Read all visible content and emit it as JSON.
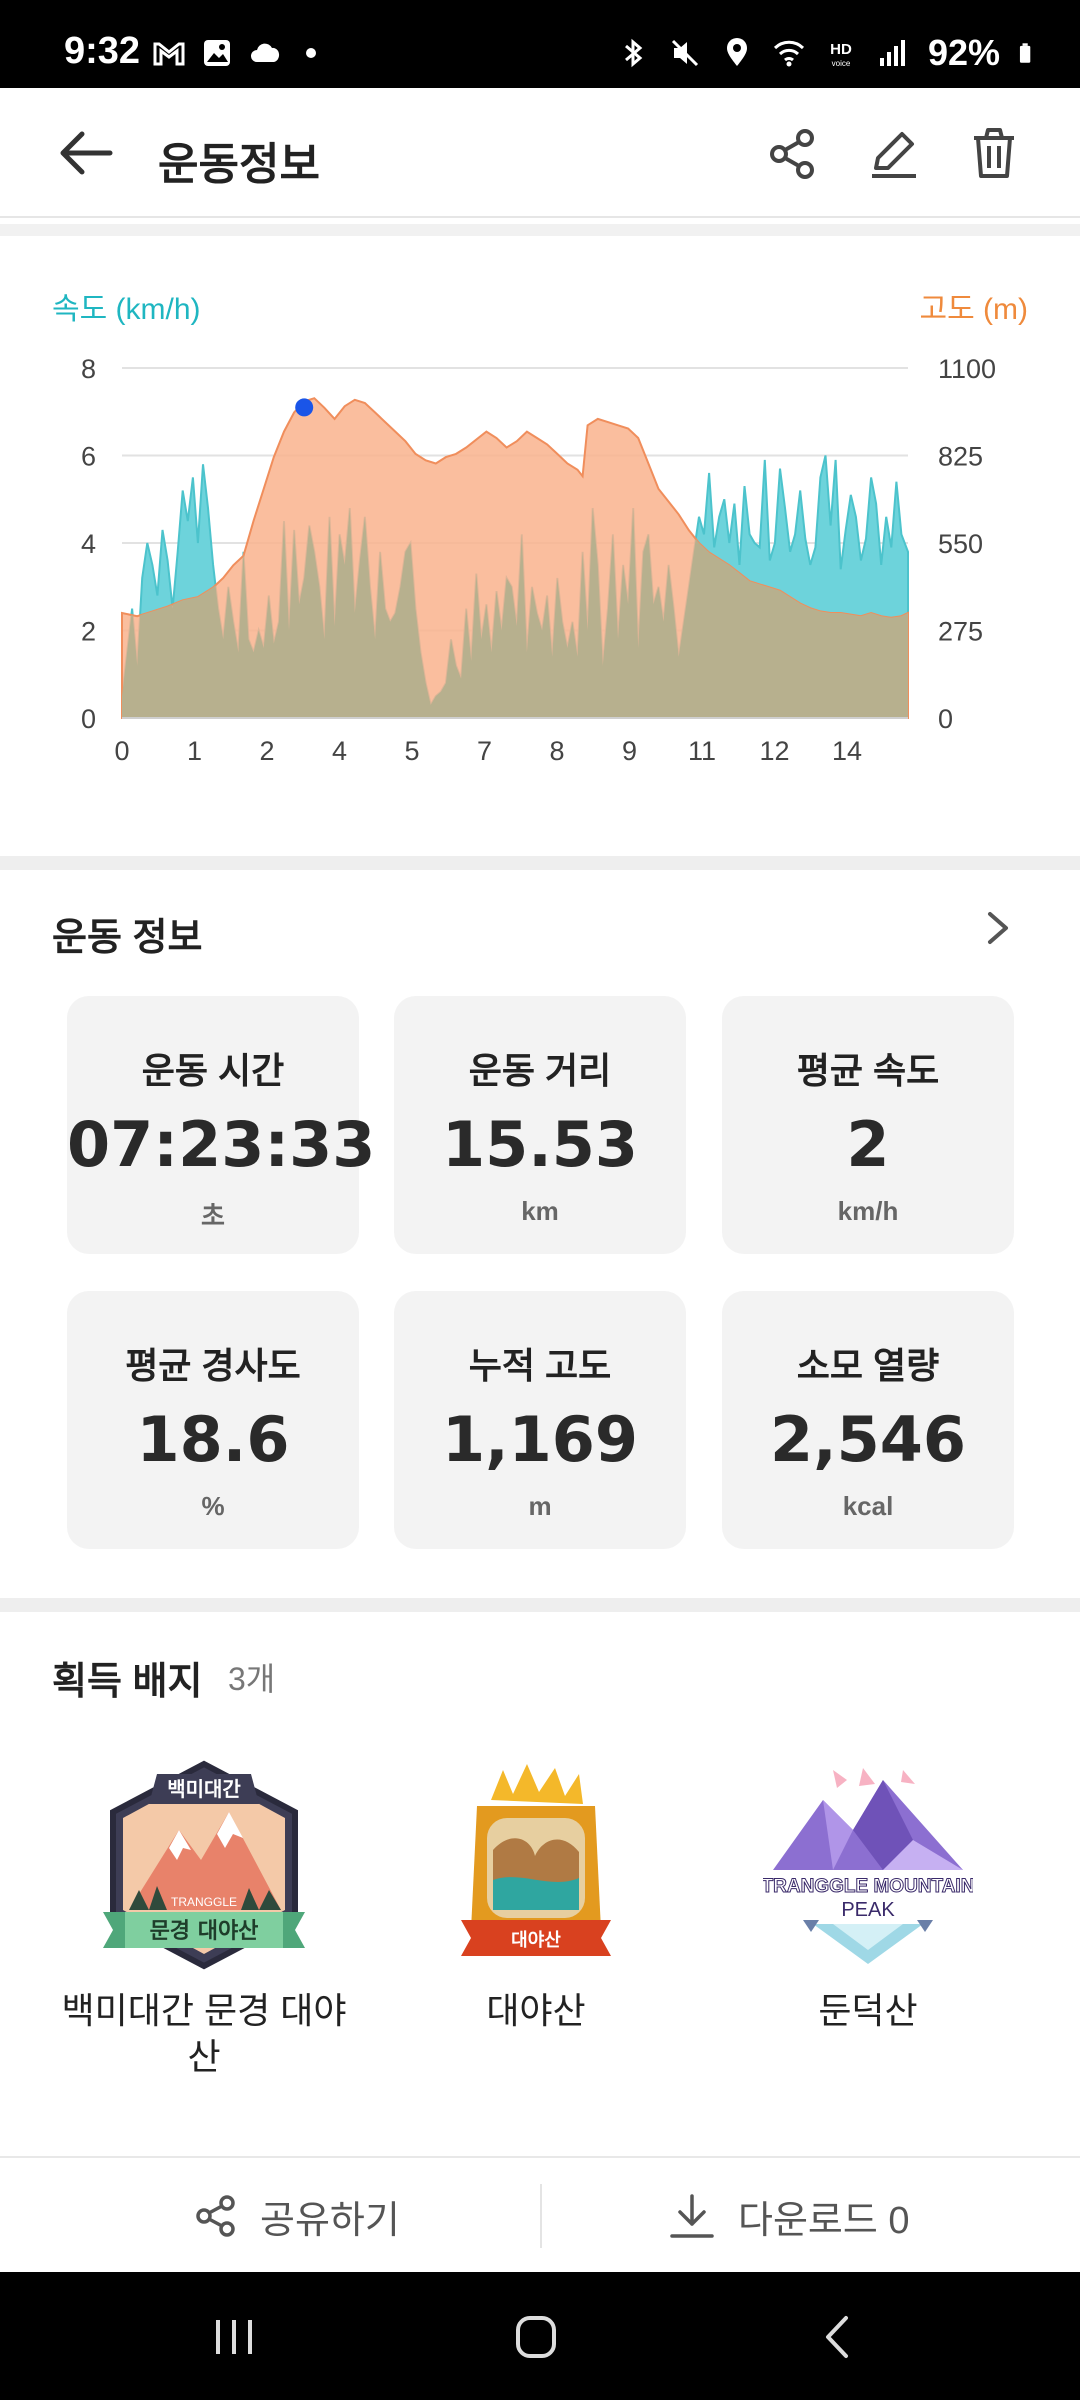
{
  "status_bar": {
    "time": "9:32",
    "battery": "92%",
    "left_icons": [
      "gmail-icon",
      "gallery-icon",
      "cloud-icon",
      "dot"
    ],
    "right_icons": [
      "bluetooth-icon",
      "mute-icon",
      "location-icon",
      "wifi-icon",
      "hd-voice-icon",
      "signal-icon",
      "battery-icon"
    ]
  },
  "app_bar": {
    "title": "운동정보",
    "actions": [
      "share-icon",
      "edit-icon",
      "trash-icon"
    ]
  },
  "chart": {
    "left_axis_label": "속도 (km/h)",
    "right_axis_label": "고도 (m)",
    "colors": {
      "speed": "#6dd3db",
      "altitude": "#f9b38d",
      "overlap": "#b7b08e",
      "marker": "#1a55e8"
    }
  },
  "chart_data": {
    "type": "area",
    "xlabel": "",
    "x_ticks": [
      "0",
      "1",
      "2",
      "4",
      "5",
      "7",
      "8",
      "9",
      "11",
      "12",
      "14"
    ],
    "x_range": [
      0,
      15.53
    ],
    "y_left": {
      "label": "속도 (km/h)",
      "ticks": [
        "8",
        "6",
        "4",
        "2",
        "0"
      ],
      "range": [
        0,
        8
      ]
    },
    "y_right": {
      "label": "고도 (m)",
      "ticks": [
        "1100",
        "825",
        "550",
        "275",
        "0"
      ],
      "range": [
        0,
        1100
      ]
    },
    "grid": true,
    "series": [
      {
        "name": "속도 (km/h)",
        "axis": "left",
        "x": [
          0,
          0.1,
          0.2,
          0.3,
          0.4,
          0.5,
          0.6,
          0.7,
          0.8,
          0.9,
          1.0,
          1.1,
          1.2,
          1.3,
          1.4,
          1.5,
          1.6,
          1.7,
          1.8,
          1.9,
          2.0,
          2.1,
          2.2,
          2.3,
          2.4,
          2.5,
          2.6,
          2.7,
          2.8,
          2.9,
          3.0,
          3.1,
          3.2,
          3.3,
          3.4,
          3.5,
          3.6,
          3.7,
          3.8,
          3.9,
          4.0,
          4.1,
          4.2,
          4.3,
          4.4,
          4.5,
          4.6,
          4.7,
          4.8,
          4.9,
          5.0,
          5.1,
          5.2,
          5.3,
          5.4,
          5.5,
          5.6,
          5.7,
          5.8,
          5.9,
          6.0,
          6.1,
          6.2,
          6.3,
          6.4,
          6.5,
          6.6,
          6.7,
          6.8,
          6.9,
          7.0,
          7.1,
          7.2,
          7.3,
          7.4,
          7.5,
          7.6,
          7.7,
          7.8,
          7.9,
          8.0,
          8.1,
          8.2,
          8.3,
          8.4,
          8.5,
          8.6,
          8.7,
          8.8,
          8.9,
          9.0,
          9.1,
          9.2,
          9.3,
          9.4,
          9.5,
          9.6,
          9.7,
          9.8,
          9.9,
          10.0,
          10.1,
          10.2,
          10.3,
          10.4,
          10.5,
          10.6,
          10.7,
          10.8,
          10.9,
          11.0,
          11.1,
          11.2,
          11.3,
          11.4,
          11.5,
          11.6,
          11.7,
          11.8,
          11.9,
          12.0,
          12.1,
          12.2,
          12.3,
          12.4,
          12.5,
          12.6,
          12.7,
          12.8,
          12.9,
          13.0,
          13.1,
          13.2,
          13.3,
          13.4,
          13.5,
          13.6,
          13.7,
          13.8,
          13.9,
          14.0,
          14.1,
          14.2,
          14.3,
          14.4,
          14.5,
          14.6,
          14.7,
          14.8,
          14.9,
          15.0,
          15.1,
          15.2,
          15.3,
          15.4,
          15.53
        ],
        "values": [
          0.5,
          1.5,
          2.5,
          1.2,
          3.2,
          4.0,
          3.5,
          2.8,
          4.3,
          3.6,
          2.5,
          3.8,
          5.2,
          4.5,
          5.5,
          4.0,
          5.8,
          4.8,
          3.5,
          2.5,
          1.8,
          3.0,
          2.2,
          1.5,
          3.8,
          1.8,
          1.5,
          2.0,
          1.6,
          2.8,
          1.7,
          2.2,
          4.5,
          2.0,
          4.3,
          2.6,
          3.2,
          4.4,
          3.8,
          3.0,
          1.8,
          4.6,
          2.1,
          4.2,
          3.5,
          4.8,
          2.4,
          3.6,
          4.6,
          3.0,
          1.8,
          3.8,
          2.5,
          2.2,
          2.4,
          3.0,
          3.8,
          4.0,
          2.5,
          1.5,
          0.8,
          0.3,
          0.5,
          0.6,
          0.8,
          1.8,
          1.2,
          0.9,
          2.5,
          1.3,
          3.3,
          1.8,
          2.6,
          1.5,
          2.9,
          2.0,
          3.2,
          3.0,
          2.1,
          4.2,
          1.5,
          3.0,
          2.4,
          2.0,
          2.8,
          1.4,
          3.2,
          2.2,
          1.6,
          2.2,
          1.4,
          3.8,
          2.0,
          4.8,
          3.5,
          1.2,
          2.5,
          4.2,
          1.8,
          3.5,
          2.6,
          4.8,
          1.6,
          3.8,
          4.2,
          2.6,
          3.0,
          2.2,
          3.5,
          2.5,
          1.4,
          2.2,
          3.0,
          3.8,
          4.6,
          4.2,
          5.6,
          3.9,
          4.6,
          5.0,
          4.0,
          4.9,
          3.5,
          5.3,
          4.2,
          4.0,
          3.9,
          5.9,
          3.6,
          4.0,
          5.7,
          4.8,
          3.8,
          4.2,
          5.2,
          4.1,
          3.5,
          3.9,
          5.5,
          6.0,
          4.4,
          5.9,
          3.4,
          4.3,
          5.1,
          4.6,
          3.6,
          4.1,
          5.5,
          4.9,
          3.5,
          4.6,
          3.9,
          5.4,
          4.2,
          3.8
        ]
      },
      {
        "name": "고도 (m)",
        "axis": "right",
        "x": [
          0,
          0.3,
          0.6,
          0.9,
          1.2,
          1.5,
          1.8,
          2.0,
          2.2,
          2.4,
          2.6,
          2.8,
          3.0,
          3.2,
          3.4,
          3.6,
          3.8,
          4.0,
          4.2,
          4.4,
          4.6,
          4.8,
          5.0,
          5.2,
          5.4,
          5.6,
          5.8,
          6.0,
          6.2,
          6.4,
          6.6,
          6.8,
          7.0,
          7.2,
          7.4,
          7.6,
          7.8,
          8.0,
          8.2,
          8.4,
          8.6,
          8.8,
          9.0,
          9.1,
          9.2,
          9.4,
          9.6,
          9.8,
          10.0,
          10.2,
          10.4,
          10.6,
          10.8,
          11.0,
          11.2,
          11.4,
          11.6,
          11.8,
          12.0,
          12.2,
          12.4,
          12.6,
          12.8,
          13.0,
          13.2,
          13.4,
          13.6,
          13.8,
          14.0,
          14.2,
          14.4,
          14.6,
          14.8,
          15.0,
          15.2,
          15.4,
          15.53
        ],
        "values": [
          330,
          320,
          335,
          350,
          370,
          380,
          410,
          440,
          480,
          510,
          620,
          720,
          820,
          900,
          960,
          995,
          1005,
          975,
          940,
          980,
          1000,
          990,
          960,
          930,
          900,
          870,
          830,
          810,
          800,
          820,
          830,
          850,
          875,
          900,
          880,
          850,
          870,
          900,
          880,
          860,
          830,
          800,
          780,
          760,
          920,
          940,
          930,
          920,
          910,
          880,
          800,
          720,
          680,
          640,
          590,
          550,
          520,
          500,
          480,
          455,
          430,
          420,
          410,
          400,
          380,
          360,
          345,
          335,
          330,
          330,
          325,
          320,
          330,
          320,
          315,
          320,
          330
        ]
      }
    ],
    "marker": {
      "x": 3.6,
      "series": "고도 (m)"
    }
  },
  "stats": {
    "section_title": "운동 정보",
    "cards": [
      {
        "label": "운동 시간",
        "value": "07:23:33",
        "unit": "초"
      },
      {
        "label": "운동 거리",
        "value": "15.53",
        "unit": "km"
      },
      {
        "label": "평균 속도",
        "value": "2",
        "unit": "km/h"
      },
      {
        "label": "평균 경사도",
        "value": "18.6",
        "unit": "%"
      },
      {
        "label": "누적 고도",
        "value": "1,169",
        "unit": "m"
      },
      {
        "label": "소모 열량",
        "value": "2,546",
        "unit": "kcal"
      }
    ]
  },
  "badges": {
    "section_title": "획득 배지",
    "count": "3개",
    "items": [
      {
        "name": "백미대간 문경 대야\n산",
        "line1": "백미대간 문경 대야",
        "line2": "산",
        "top_text": "백미대간",
        "brand_text": "TRANGGLE",
        "ribbon_text": "문경 대야산"
      },
      {
        "name": "대야산",
        "ribbon_text": "대야산"
      },
      {
        "name": "둔덕산",
        "brand_text": "TRANGGLE MOUNTAIN",
        "sub_text": "PEAK"
      }
    ]
  },
  "bottom_bar": {
    "share_label": "공유하기",
    "download_label": "다운로드 0"
  }
}
